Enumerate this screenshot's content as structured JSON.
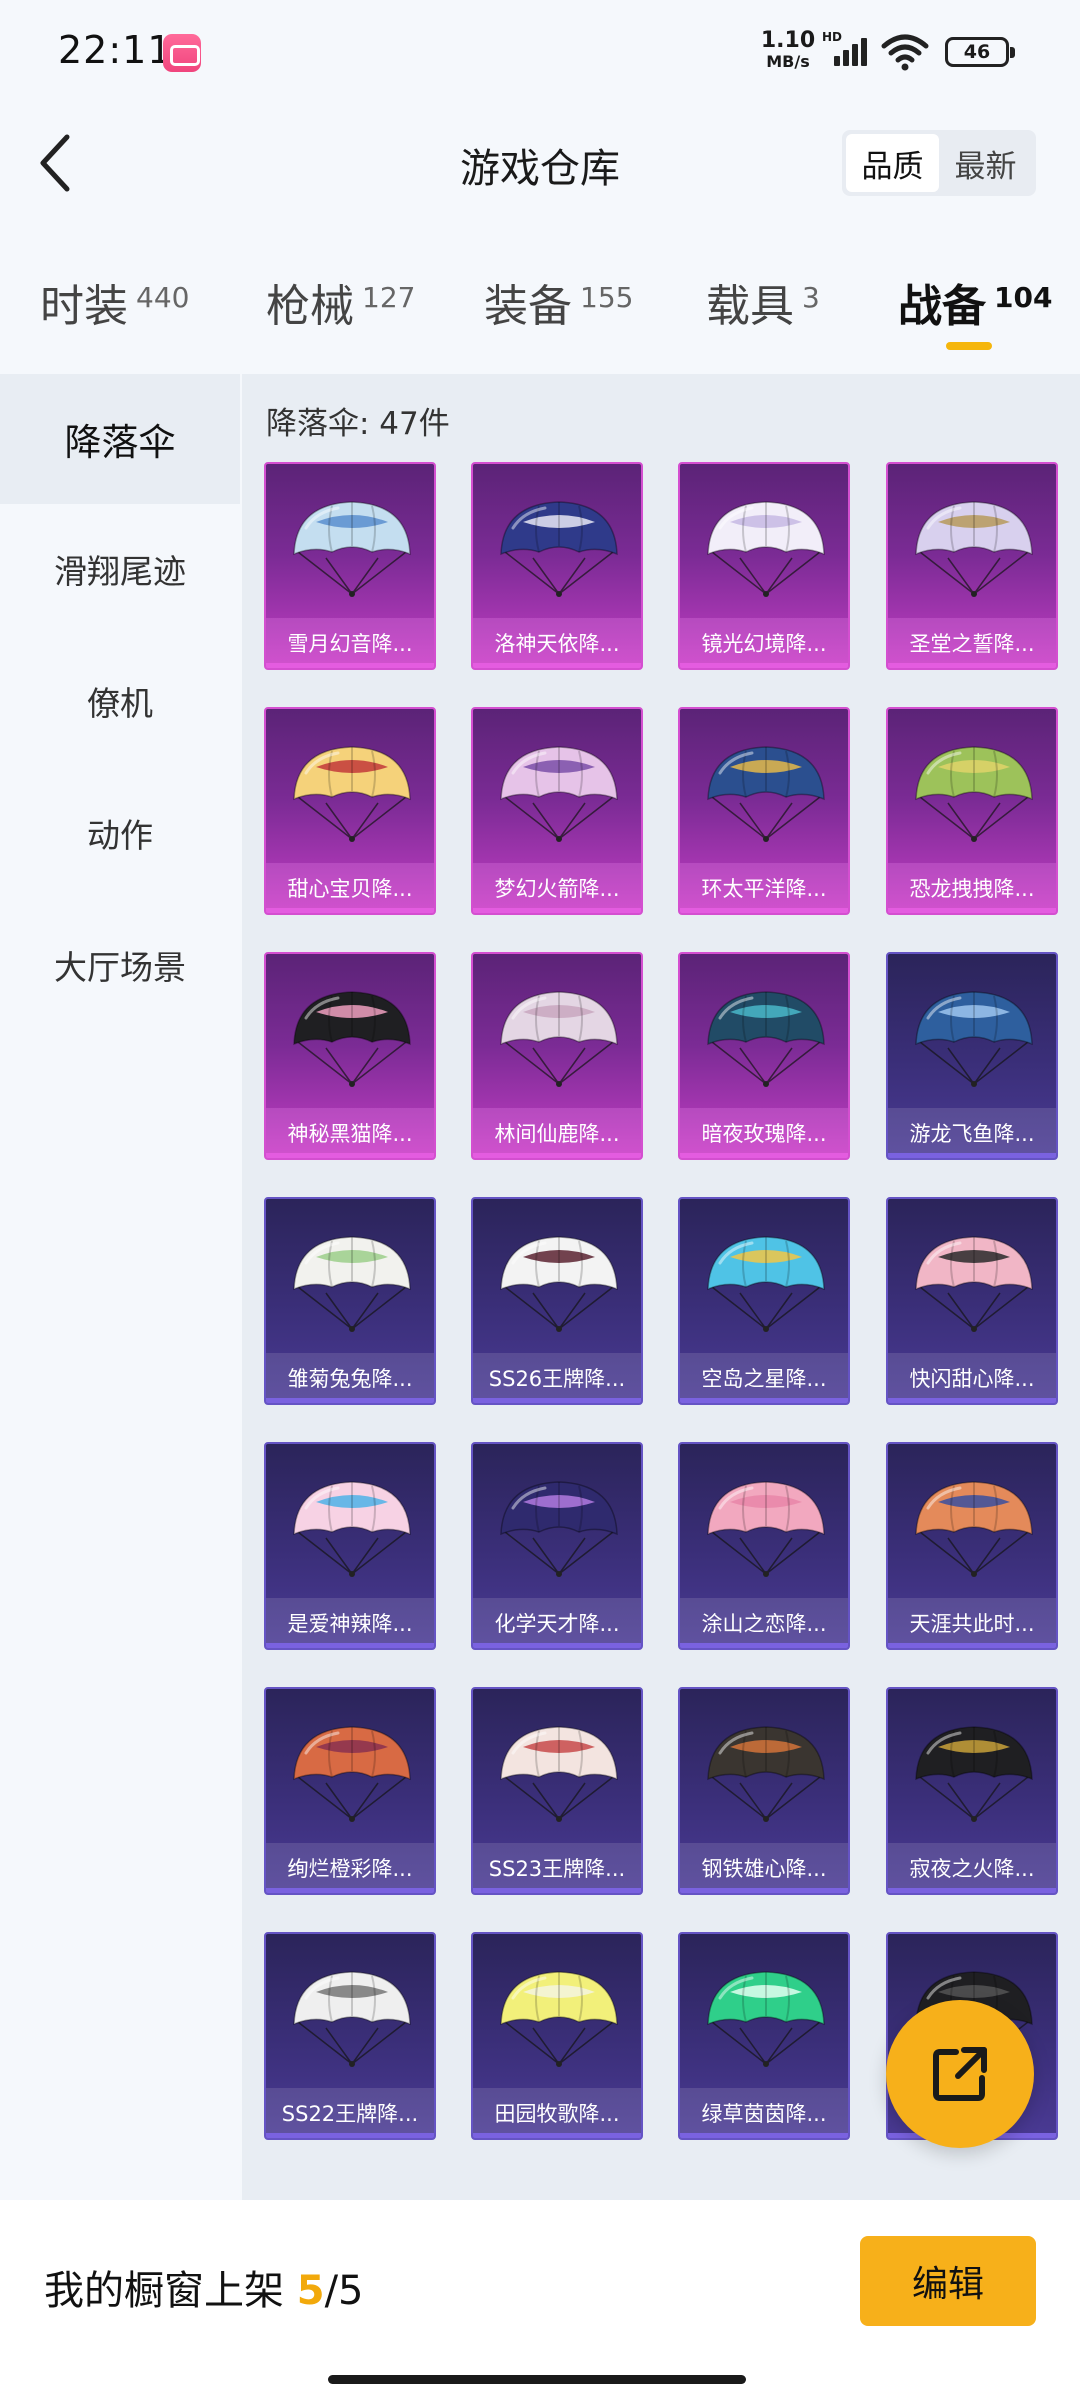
{
  "status_bar": {
    "time": "22:11",
    "net_speed_value": "1.10",
    "net_speed_unit": "MB/s",
    "hd_label": "HD",
    "battery": "46"
  },
  "header": {
    "title": "游戏仓库",
    "sort_options": [
      "品质",
      "最新"
    ],
    "active_sort": "品质"
  },
  "tabs": [
    {
      "label": "时装",
      "count": "440"
    },
    {
      "label": "枪械",
      "count": "127"
    },
    {
      "label": "装备",
      "count": "155"
    },
    {
      "label": "载具",
      "count": "3"
    },
    {
      "label": "战备",
      "count": "104"
    }
  ],
  "active_tab": "战备",
  "sidebar": {
    "items": [
      {
        "label": "降落伞"
      },
      {
        "label": "滑翔尾迹"
      },
      {
        "label": "僚机"
      },
      {
        "label": "动作"
      },
      {
        "label": "大厅场景"
      }
    ],
    "active": "降落伞"
  },
  "content": {
    "count_label": "降落伞: 47件",
    "items": [
      {
        "name": "雪月幻音降...",
        "rarity": "purple",
        "canopy": "#c4def0",
        "accent": "#5a8fcf"
      },
      {
        "name": "洛神天依降...",
        "rarity": "purple",
        "canopy": "#2f3a8a",
        "accent": "#e8e8f5"
      },
      {
        "name": "镜光幻境降...",
        "rarity": "purple",
        "canopy": "#f2eef9",
        "accent": "#c7b9e4"
      },
      {
        "name": "圣堂之誓降...",
        "rarity": "purple",
        "canopy": "#d8d0ee",
        "accent": "#b79a5c"
      },
      {
        "name": "甜心宝贝降...",
        "rarity": "purple",
        "canopy": "#f5d27a",
        "accent": "#c23a3a"
      },
      {
        "name": "梦幻火箭降...",
        "rarity": "purple",
        "canopy": "#e6c3e8",
        "accent": "#7a4fa8"
      },
      {
        "name": "环太平洋降...",
        "rarity": "purple",
        "canopy": "#2b4f8f",
        "accent": "#e5b94a"
      },
      {
        "name": "恐龙拽拽降...",
        "rarity": "purple",
        "canopy": "#9dc25a",
        "accent": "#e1d36a"
      },
      {
        "name": "神秘黑猫降...",
        "rarity": "purple",
        "canopy": "#1f1f22",
        "accent": "#f0a0c0"
      },
      {
        "name": "林间仙鹿降...",
        "rarity": "purple",
        "canopy": "#e4d6e4",
        "accent": "#c9a7c0"
      },
      {
        "name": "暗夜玫瑰降...",
        "rarity": "purple",
        "canopy": "#214b66",
        "accent": "#49b7c9"
      },
      {
        "name": "游龙飞鱼降...",
        "rarity": "blue",
        "canopy": "#2e5f9e",
        "accent": "#9ec6ee"
      },
      {
        "name": "雏菊兔兔降...",
        "rarity": "blue",
        "canopy": "#f2f2ee",
        "accent": "#9ccf8a"
      },
      {
        "name": "SS26王牌降...",
        "rarity": "blue",
        "canopy": "#f3f3f3",
        "accent": "#5a2230"
      },
      {
        "name": "空岛之星降...",
        "rarity": "blue",
        "canopy": "#4fc3e6",
        "accent": "#f2c744"
      },
      {
        "name": "快闪甜心降...",
        "rarity": "blue",
        "canopy": "#f1b6c6",
        "accent": "#2a2a2a"
      },
      {
        "name": "是爱神辣降...",
        "rarity": "blue",
        "canopy": "#f7d2e4",
        "accent": "#4fb3e8"
      },
      {
        "name": "化学天才降...",
        "rarity": "blue",
        "canopy": "#2f2a6e",
        "accent": "#b27ae0"
      },
      {
        "name": "涂山之恋降...",
        "rarity": "blue",
        "canopy": "#f2a8bf",
        "accent": "#e986a8"
      },
      {
        "name": "天涯共此时...",
        "rarity": "blue",
        "canopy": "#e48a5a",
        "accent": "#3a4fa0"
      },
      {
        "name": "绚烂橙彩降...",
        "rarity": "blue",
        "canopy": "#d86a44",
        "accent": "#8a3050"
      },
      {
        "name": "SS23王牌降...",
        "rarity": "blue",
        "canopy": "#f3e4e0",
        "accent": "#c74a4a"
      },
      {
        "name": "钢铁雄心降...",
        "rarity": "blue",
        "canopy": "#3a3530",
        "accent": "#d4733a"
      },
      {
        "name": "寂夜之火降...",
        "rarity": "blue",
        "canopy": "#1f1f22",
        "accent": "#c9a23a"
      },
      {
        "name": "SS22王牌降...",
        "rarity": "blue",
        "canopy": "#efefef",
        "accent": "#777777"
      },
      {
        "name": "田园牧歌降...",
        "rarity": "blue",
        "canopy": "#f2f07a",
        "accent": "#f5f5e0"
      },
      {
        "name": "绿草茵茵降...",
        "rarity": "blue",
        "canopy": "#2fcf8a",
        "accent": "#e0fff0"
      },
      {
        "name": "",
        "rarity": "blue",
        "canopy": "#1f1f22",
        "accent": "#555555"
      }
    ]
  },
  "bottom": {
    "shelf_label": "我的橱窗上架",
    "shelf_current": "5",
    "shelf_sep": "/",
    "shelf_total": "5",
    "edit_label": "编辑"
  }
}
